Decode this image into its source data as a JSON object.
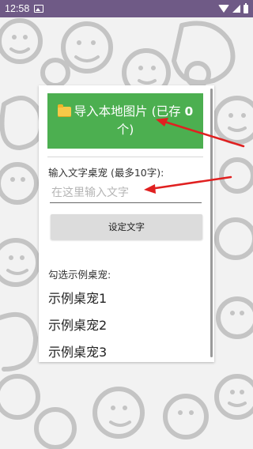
{
  "status_bar": {
    "time": "12:58",
    "icons": [
      "image-notification-icon",
      "wifi-icon",
      "signal-icon",
      "battery-icon"
    ]
  },
  "import_button": {
    "icon": "folder-icon",
    "label_prefix": "导入本地图片 (已存 ",
    "count": "0",
    "label_suffix": " 个)"
  },
  "text_input": {
    "label": "输入文字桌宠 (最多10字):",
    "placeholder": "在这里输入文字",
    "value": ""
  },
  "set_text_button": {
    "label": "设定文字"
  },
  "samples": {
    "title": "勾选示例桌宠:",
    "items": [
      "示例桌宠1",
      "示例桌宠2",
      "示例桌宠3"
    ]
  },
  "colors": {
    "status_bar": "#6f5a86",
    "import_button": "#4caf50",
    "annotation_arrow": "#e02020"
  }
}
